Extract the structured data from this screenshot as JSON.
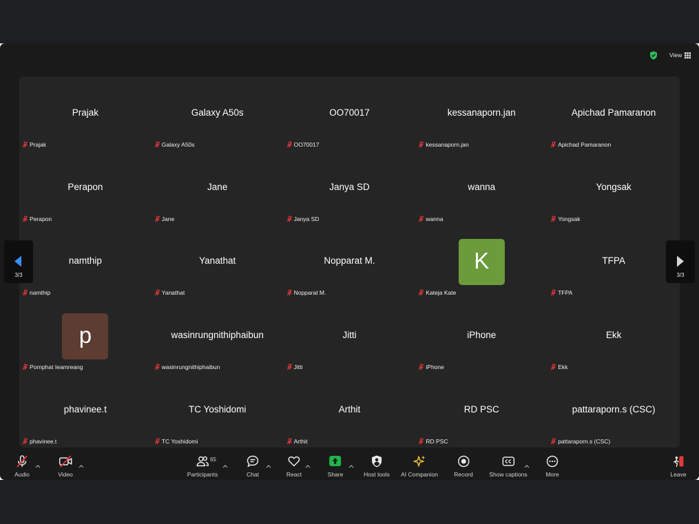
{
  "colors": {
    "page_bg": "#1d1f22",
    "window_bg": "#1a1a1a",
    "gallery_bg": "#252525",
    "muted_red": "#e5373a",
    "accent_blue": "#3d8ef7",
    "share_green": "#22b34c",
    "security_green": "#2fbf5a",
    "ai_gold": "#e9b83c"
  },
  "top_bar": {
    "security_icon": "shield-check-icon",
    "view_label": "View",
    "view_icon": "grid-icon"
  },
  "gallery": {
    "label_icon": "mic-muted-icon",
    "tiles": [
      {
        "display_name": "Prajak",
        "label": "Prajak"
      },
      {
        "display_name": "Galaxy A50s",
        "label": "Galaxy A50s"
      },
      {
        "display_name": "OO70017",
        "label": "OO70017"
      },
      {
        "display_name": "kessanaporn.jan",
        "label": "kessanaporn.jan"
      },
      {
        "display_name": "Apichad Pamaranon",
        "label": "Apichad Pamaranon"
      },
      {
        "display_name": "Perapon",
        "label": "Perapon"
      },
      {
        "display_name": "Jane",
        "label": "Jane"
      },
      {
        "display_name": "Janya SD",
        "label": "Janya SD"
      },
      {
        "display_name": "wanna",
        "label": "wanna"
      },
      {
        "display_name": "Yongsak",
        "label": "Yongsak"
      },
      {
        "display_name": "namthip",
        "label": "namthip"
      },
      {
        "display_name": "Yanathat",
        "label": "Yanathat"
      },
      {
        "display_name": "Nopparat M.",
        "label": "Nopparat M."
      },
      {
        "avatar_letter": "K",
        "avatar_color": "#6b9b3a",
        "label": "Kateja Kate"
      },
      {
        "display_name": "TFPA",
        "label": "TFPA"
      },
      {
        "avatar_letter": "p",
        "avatar_color": "#5d3c31",
        "label": "Pornphat Ieamreang"
      },
      {
        "display_name": "wasinrungnithiphaibun",
        "label": "wasinrungnithiphaibun"
      },
      {
        "display_name": "Jitti",
        "label": "Jitti"
      },
      {
        "display_name": "iPhone",
        "label": "iPhone"
      },
      {
        "display_name": "Ekk",
        "label": "Ekk"
      },
      {
        "display_name": "phavinee.t",
        "label": "phavinee.t"
      },
      {
        "display_name": "TC Yoshidomi",
        "label": "TC Yoshidomi"
      },
      {
        "display_name": "Arthit",
        "label": "Arthit"
      },
      {
        "display_name": "RD PSC",
        "label": "RD PSC"
      },
      {
        "display_name": "pattaraporn.s (CSC)",
        "label": "pattaraporn.s (CSC)"
      }
    ]
  },
  "pagination": {
    "prev": {
      "icon": "arrow-left-icon",
      "page": "3/3"
    },
    "next": {
      "icon": "arrow-right-icon",
      "page": "3/3"
    }
  },
  "toolbar": {
    "audio": {
      "label": "Audio",
      "icon": "mic-muted-icon"
    },
    "video": {
      "label": "Video",
      "icon": "video-muted-icon"
    },
    "participants": {
      "label": "Participants",
      "icon": "participants-icon",
      "count": "65"
    },
    "chat": {
      "label": "Chat",
      "icon": "chat-icon"
    },
    "react": {
      "label": "React",
      "icon": "heart-icon"
    },
    "share": {
      "label": "Share",
      "icon": "share-screen-icon"
    },
    "host_tools": {
      "label": "Host tools",
      "icon": "shield-icon"
    },
    "ai_companion": {
      "label": "AI Companion",
      "icon": "sparkle-icon"
    },
    "record": {
      "label": "Record",
      "icon": "record-icon"
    },
    "captions": {
      "label": "Show captions",
      "icon": "cc-icon"
    },
    "more": {
      "label": "More",
      "icon": "more-icon"
    },
    "leave": {
      "label": "Leave",
      "icon": "leave-icon"
    }
  }
}
